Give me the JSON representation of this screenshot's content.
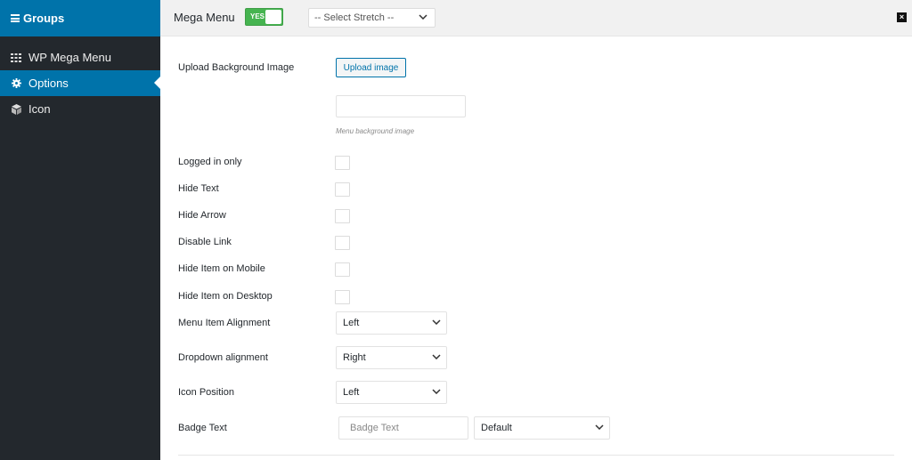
{
  "sidebar": {
    "title": "Groups",
    "items": [
      {
        "label": "WP Mega Menu",
        "icon": "grid-icon"
      },
      {
        "label": "Options",
        "icon": "gear-icon"
      },
      {
        "label": "Icon",
        "icon": "cube-icon"
      }
    ]
  },
  "topbar": {
    "title": "Mega Menu",
    "toggle_label": "YES",
    "toggle_on": true,
    "stretch_select": "-- Select Stretch --",
    "close_icon": "close-icon"
  },
  "form": {
    "upload_label": "Upload Background Image",
    "upload_button": "Upload image",
    "upload_hint": "Menu background image",
    "checkboxes": [
      {
        "label": "Logged in only",
        "checked": false
      },
      {
        "label": "Hide Text",
        "checked": false
      },
      {
        "label": "Hide Arrow",
        "checked": false
      },
      {
        "label": "Disable Link",
        "checked": false
      },
      {
        "label": "Hide Item on Mobile",
        "checked": false
      },
      {
        "label": "Hide Item on Desktop",
        "checked": false
      }
    ],
    "menu_item_alignment": {
      "label": "Menu Item Alignment",
      "value": "Left"
    },
    "dropdown_alignment": {
      "label": "Dropdown alignment",
      "value": "Right"
    },
    "icon_position": {
      "label": "Icon Position",
      "value": "Left"
    },
    "badge": {
      "label": "Badge Text",
      "placeholder": "Badge Text",
      "style_value": "Default"
    }
  },
  "colors": {
    "sidebar_bg": "#23282d",
    "accent": "#0073aa",
    "toggle_on": "#46b450"
  }
}
